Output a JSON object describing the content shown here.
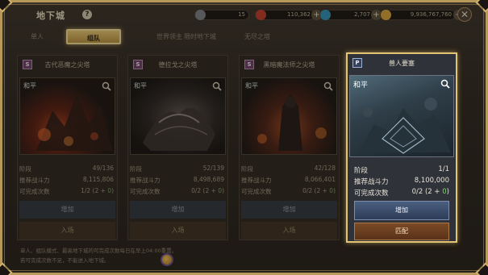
{
  "header": {
    "title": "地下城",
    "help_label": "?",
    "close_label": "✕",
    "resources": [
      {
        "name": "stamina",
        "value": "15",
        "color": "#7a7f86"
      },
      {
        "name": "red-gem",
        "value": "110,362",
        "color": "#c0392b"
      },
      {
        "name": "blue-gem",
        "value": "2,707",
        "color": "#2f8fb5"
      },
      {
        "name": "gold",
        "value": "9,936,767,760",
        "color": "#d4a13a"
      }
    ],
    "plus_label": "+"
  },
  "tabs": [
    {
      "label": "单人",
      "active": false
    },
    {
      "label": "组队",
      "active": true
    },
    {
      "label": "世界领主",
      "active": false
    },
    {
      "label": "限时地下城",
      "active": false
    },
    {
      "label": "无尽之塔",
      "active": false
    }
  ],
  "cards": [
    {
      "badge": "S",
      "name": "古代恶魔之尖塔",
      "state": "和平",
      "stage_label": "阶段",
      "stage": "49/136",
      "power_label": "推荐战斗力",
      "power": "8,115,806",
      "clears_label": "可完成次数",
      "clears_a": "1/2 (2 + ",
      "clears_b": "0",
      "clears_c": ")",
      "btn1": "增加",
      "btn2": "入场"
    },
    {
      "badge": "S",
      "name": "德拉戈之尖塔",
      "state": "和平",
      "stage_label": "阶段",
      "stage": "52/139",
      "power_label": "推荐战斗力",
      "power": "8,498,689",
      "clears_label": "可完成次数",
      "clears_a": "0/2 (2 + ",
      "clears_b": "0",
      "clears_c": ")",
      "btn1": "增加",
      "btn2": "入场"
    },
    {
      "badge": "S",
      "name": "黑暗魔法师之尖塔",
      "state": "和平",
      "stage_label": "阶段",
      "stage": "42/128",
      "power_label": "推荐战斗力",
      "power": "8,066,401",
      "clears_label": "可完成次数",
      "clears_a": "0/2 (2 + ",
      "clears_b": "0",
      "clears_c": ")",
      "btn1": "增加",
      "btn2": "入场"
    },
    {
      "badge": "P",
      "name": "兽人要塞",
      "state": "和平",
      "stage_label": "阶段",
      "stage": "1/1",
      "power_label": "推荐战斗力",
      "power": "8,100,000",
      "clears_label": "可完成次数",
      "clears_a": "0/2 (2 + ",
      "clears_b": "0",
      "clears_c": ")",
      "btn1": "增加",
      "btn2": "匹配"
    }
  ],
  "notes": [
    "单人、组队模式、最高地下城的可完成次数每日在早上04:00重置。",
    "若可完成次数不足，不能进入地下城。"
  ]
}
